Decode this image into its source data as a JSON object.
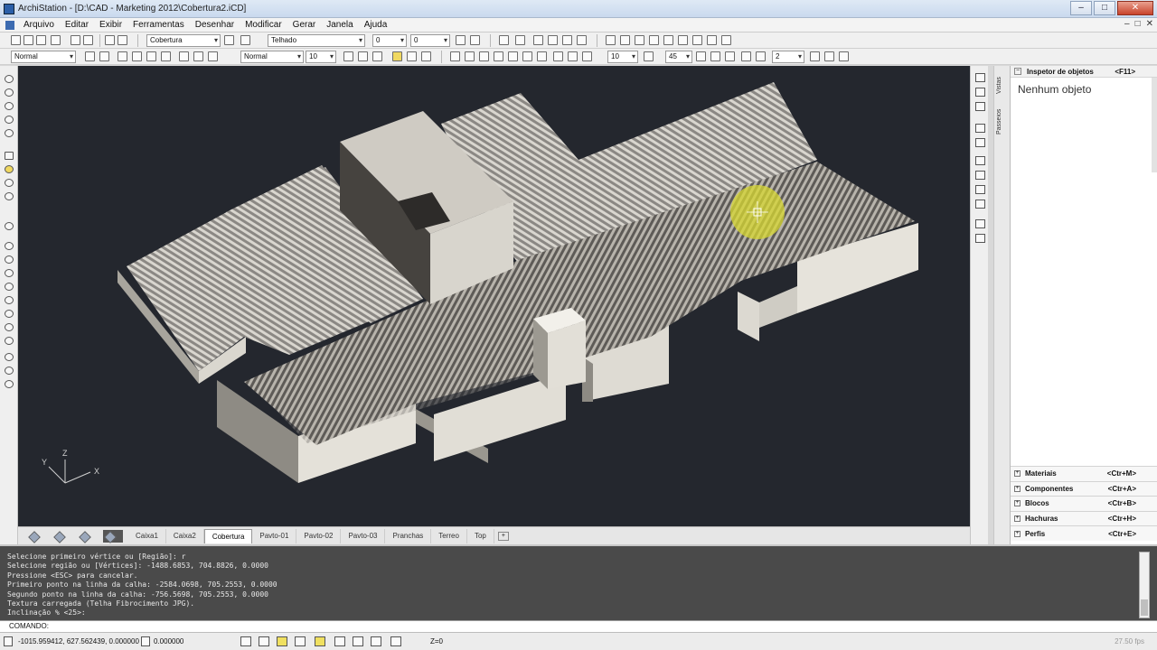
{
  "window": {
    "title": "ArchiStation - [D:\\CAD - Marketing 2012\\Cobertura2.iCD]",
    "min": "–",
    "max": "□",
    "close": "✕"
  },
  "menu": [
    "Arquivo",
    "Editar",
    "Exibir",
    "Ferramentas",
    "Desenhar",
    "Modificar",
    "Gerar",
    "Janela",
    "Ajuda"
  ],
  "toolbar": {
    "layer_combo": "Cobertura",
    "material_combo": "Telhado",
    "thickness": "0",
    "elevation": "0",
    "style_combo": "Normal",
    "text_style_combo": "Normal",
    "text_size": "10",
    "dim_value": "10",
    "angle_value": "45",
    "count_value": "2"
  },
  "viewport": {
    "axis_labels": {
      "x": "X",
      "y": "Y",
      "z": "Z"
    },
    "background": "#24272e",
    "highlight_color": "#d8d832"
  },
  "tabs": {
    "items": [
      "Caixa1",
      "Caixa2",
      "Cobertura",
      "Pavto-01",
      "Pavto-02",
      "Pavto-03",
      "Pranchas",
      "Terreo",
      "Top"
    ],
    "active": "Cobertura"
  },
  "inspector": {
    "title": "Inspetor de objetos",
    "shortcut": "<F11>",
    "empty_text": "Nenhum objeto",
    "vertical_tabs": [
      "Vistas",
      "Passeios"
    ]
  },
  "panels": [
    {
      "label": "Materiais",
      "shortcut": "<Ctr+M>"
    },
    {
      "label": "Componentes",
      "shortcut": "<Ctr+A>"
    },
    {
      "label": "Blocos",
      "shortcut": "<Ctr+B>"
    },
    {
      "label": "Hachuras",
      "shortcut": "<Ctr+H>"
    },
    {
      "label": "Perfis",
      "shortcut": "<Ctr+E>"
    }
  ],
  "console": {
    "lines": [
      "Selecione primeiro vértice ou [Região]: r",
      "Selecione região ou [Vértices]: -1488.6853, 704.8826, 0.0000",
      "Pressione <ESC> para cancelar.",
      "Primeiro ponto na linha da calha: -2584.0698, 705.2553, 0.0000",
      "Segundo ponto na linha da calha: -756.5698, 705.2553, 0.0000",
      "Textura carregada (Telha Fibrocimento JPG).",
      "Inclinação % <25>:"
    ],
    "prompt": "COMANDO:"
  },
  "status": {
    "coords": "-1015.959412, 627.562439, 0.000000",
    "scale": "0.000000",
    "z": "Z=0",
    "fps": "27.50 fps"
  }
}
